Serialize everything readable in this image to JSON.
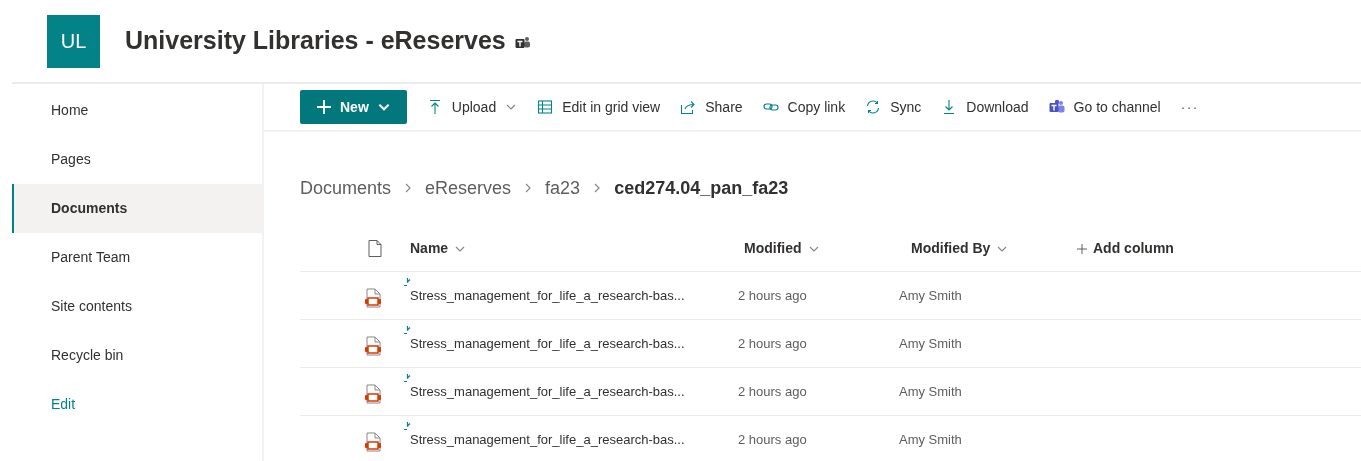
{
  "site": {
    "logo": "UL",
    "title": "University Libraries - eReserves",
    "teams_connected": true
  },
  "sidebar": {
    "items": [
      {
        "label": "Home",
        "kind": "nav",
        "selected": false
      },
      {
        "label": "Pages",
        "kind": "nav",
        "selected": false
      },
      {
        "label": "Documents",
        "kind": "nav",
        "selected": true
      },
      {
        "label": "Parent Team",
        "kind": "nav",
        "selected": false
      },
      {
        "label": "Site contents",
        "kind": "nav",
        "selected": false
      },
      {
        "label": "Recycle bin",
        "kind": "nav",
        "selected": false
      },
      {
        "label": "Edit",
        "kind": "link",
        "selected": false
      }
    ]
  },
  "toolbar": {
    "new_button": {
      "label": "New"
    },
    "items": [
      {
        "label": "Upload",
        "kind": "upload",
        "dropdown": true
      },
      {
        "label": "Edit in grid view",
        "kind": "grid",
        "dropdown": false
      },
      {
        "label": "Share",
        "kind": "share",
        "dropdown": false
      },
      {
        "label": "Copy link",
        "kind": "link",
        "dropdown": false
      },
      {
        "label": "Sync",
        "kind": "sync",
        "dropdown": false
      },
      {
        "label": "Download",
        "kind": "download",
        "dropdown": false
      },
      {
        "label": "Go to channel",
        "kind": "teams",
        "dropdown": false
      }
    ],
    "more": "···"
  },
  "breadcrumb": [
    "Documents",
    "eReserves",
    "fa23",
    "ced274.04_pan_fa23"
  ],
  "table": {
    "columns": [
      {
        "label": "Name",
        "sortable": true
      },
      {
        "label": "Modified",
        "sortable": true
      },
      {
        "label": "Modified By",
        "sortable": true
      }
    ],
    "add_column": "Add column",
    "rows": [
      {
        "name": "Stress_management_for_life_a_research-bas...",
        "modified": "2 hours ago",
        "modified_by": "Amy Smith",
        "new": true
      },
      {
        "name": "Stress_management_for_life_a_research-bas...",
        "modified": "2 hours ago",
        "modified_by": "Amy Smith",
        "new": true
      },
      {
        "name": "Stress_management_for_life_a_research-bas...",
        "modified": "2 hours ago",
        "modified_by": "Amy Smith",
        "new": true
      },
      {
        "name": "Stress_management_for_life_a_research-bas...",
        "modified": "2 hours ago",
        "modified_by": "Amy Smith",
        "new": true
      }
    ]
  }
}
